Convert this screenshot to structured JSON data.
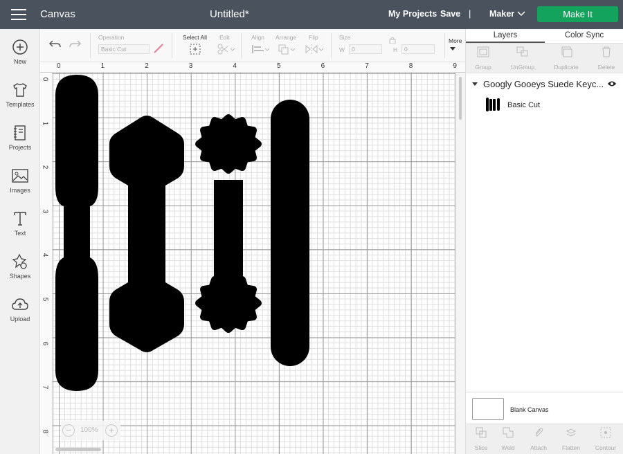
{
  "header": {
    "app_title": "Canvas",
    "doc_title": "Untitled*",
    "my_projects": "My Projects",
    "save": "Save",
    "separator": "|",
    "machine": "Maker",
    "make_it": "Make It",
    "make_it_color": "#14a35c"
  },
  "sidebar": {
    "items": [
      {
        "label": "New",
        "icon": "plus-circle-icon"
      },
      {
        "label": "Templates",
        "icon": "shirt-icon"
      },
      {
        "label": "Projects",
        "icon": "notebook-icon"
      },
      {
        "label": "Images",
        "icon": "image-icon"
      },
      {
        "label": "Text",
        "icon": "text-icon"
      },
      {
        "label": "Shapes",
        "icon": "shapes-icon"
      },
      {
        "label": "Upload",
        "icon": "cloud-upload-icon"
      }
    ]
  },
  "toolbar": {
    "operation_label": "Operation",
    "operation_value": "Basic Cut",
    "select_all": "Select All",
    "edit": "Edit",
    "align": "Align",
    "arrange": "Arrange",
    "flip": "Flip",
    "size": "Size",
    "w_label": "W",
    "w_value": "0",
    "h_label": "H",
    "h_value": "0",
    "more": "More"
  },
  "canvas": {
    "ruler_top": [
      "0",
      "1",
      "2",
      "3",
      "4",
      "5",
      "6",
      "7",
      "8",
      "9"
    ],
    "ruler_left": [
      "0",
      "1",
      "2",
      "3",
      "4",
      "5",
      "6",
      "7",
      "8"
    ],
    "zoom_minus": "−",
    "zoom_value": "100%",
    "zoom_plus": "+"
  },
  "layers_panel": {
    "tabs": [
      "Layers",
      "Color Sync"
    ],
    "tools": [
      "Group",
      "UnGroup",
      "Duplicate",
      "Delete"
    ],
    "group_name": "Googly Gooeys Suede Keyc...",
    "layer_name": "Basic Cut",
    "blank_canvas": "Blank Canvas",
    "bottom_tools": [
      "Slice",
      "Weld",
      "Attach",
      "Flatten",
      "Contour"
    ]
  }
}
